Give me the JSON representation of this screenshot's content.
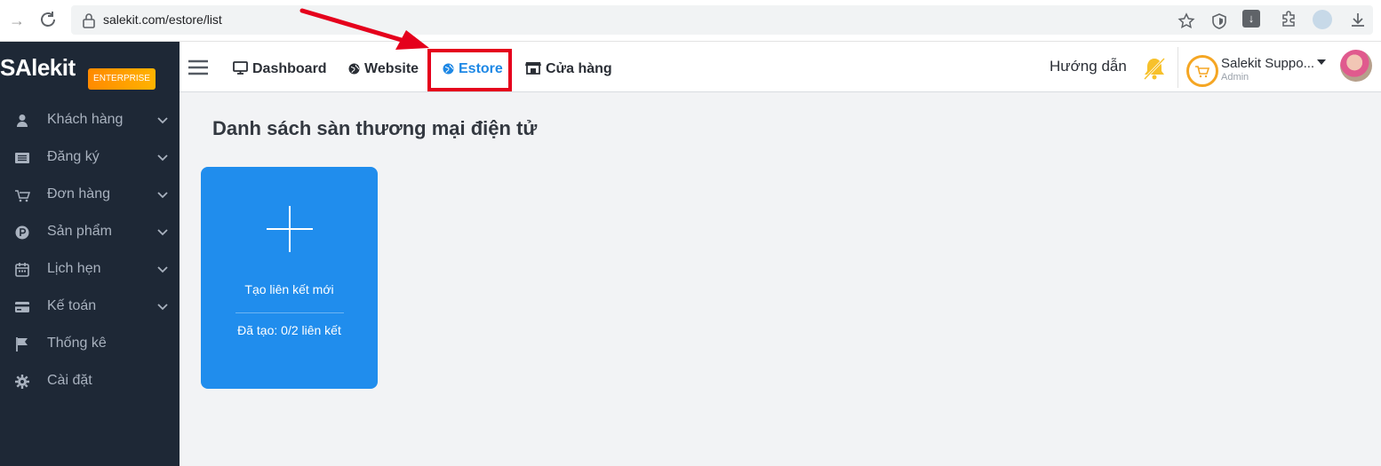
{
  "browser": {
    "url": "salekit.com/estore/list"
  },
  "sidebar": {
    "logo_text": "SAlekit",
    "logo_badge": "ENTERPRISE",
    "items": [
      {
        "label": "Khách hàng",
        "icon": "user-icon",
        "has_submenu": true
      },
      {
        "label": "Đăng ký",
        "icon": "list-icon",
        "has_submenu": true
      },
      {
        "label": "Đơn hàng",
        "icon": "cart-icon",
        "has_submenu": true
      },
      {
        "label": "Sản phẩm",
        "icon": "product-p-icon",
        "has_submenu": true
      },
      {
        "label": "Lịch hẹn",
        "icon": "calendar-icon",
        "has_submenu": true
      },
      {
        "label": "Kế toán",
        "icon": "credit-card-icon",
        "has_submenu": true
      },
      {
        "label": "Thống kê",
        "icon": "flag-icon",
        "has_submenu": false
      },
      {
        "label": "Cài đặt",
        "icon": "gear-icon",
        "has_submenu": false
      }
    ]
  },
  "topnav": {
    "links": [
      {
        "label": "Dashboard",
        "icon": "monitor-icon"
      },
      {
        "label": "Website",
        "icon": "globe-icon"
      },
      {
        "label": "Estore",
        "icon": "globe-icon",
        "active": true
      },
      {
        "label": "Cửa hàng",
        "icon": "store-icon"
      }
    ],
    "guide_label": "Hướng dẫn",
    "user_name": "Salekit Suppo...",
    "user_role": "Admin"
  },
  "main": {
    "title": "Danh sách sàn thương mại điện tử",
    "card": {
      "title": "Tạo liên kết mới",
      "count": "Đã tạo: 0/2 liên kết"
    }
  },
  "colors": {
    "sidebar_bg": "#1e2836",
    "accent": "#1e88e5",
    "card_bg": "#208ded",
    "highlight": "#e5001c"
  }
}
